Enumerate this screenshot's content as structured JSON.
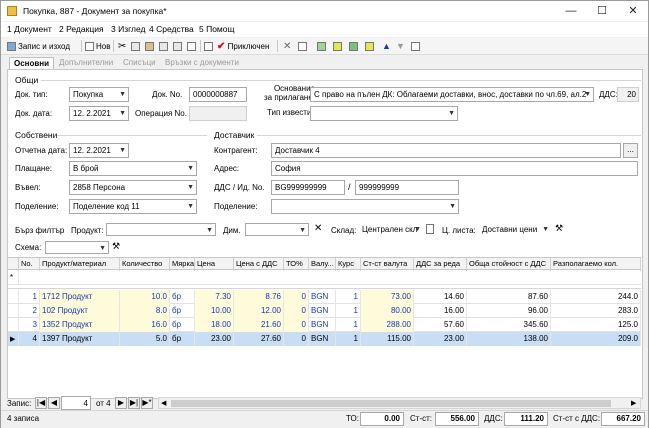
{
  "window": {
    "title": "Покупка, 887 - Документ за покупка*"
  },
  "menu": [
    "1 Документ",
    "2 Редакция",
    "3 Изглед",
    "4 Средства",
    "5 Помощ"
  ],
  "toolbar": {
    "save_close": "Запис и изход",
    "new": "Нов",
    "confirmed": "Приключен"
  },
  "tabs": [
    "Основни",
    "Допълнителни",
    "Списъци",
    "Връзки с документи"
  ],
  "general": {
    "group": "Общи",
    "doc_type_label": "Док. тип:",
    "doc_type": "Покупка",
    "doc_no_label": "Док. No.",
    "doc_no": "0000000887",
    "doc_date_label": "Док. дата:",
    "doc_date": "12.  2.2021",
    "op_no_label": "Операция No.",
    "op_no": "",
    "basis_label_1": "Основание",
    "basis_label_2": "за прилагане:",
    "basis": "С право на пълен ДК: Облагаеми доставки, внос, доставки по чл.69, ал.2",
    "vat_label": "ДДС:",
    "vat": "20",
    "notice_label": "Тип известие:",
    "notice": ""
  },
  "own": {
    "group": "Собствени",
    "report_date_label": "Отчетна дата:",
    "report_date": "12.  2.2021",
    "payment_label": "Плащане:",
    "payment": "В брой",
    "entered_label": "Въвел:",
    "entered": "2858 Персона",
    "division_label": "Поделение:",
    "division": "Поделение код 11"
  },
  "supplier": {
    "group": "Доставчик",
    "partner_label": "Контрагент:",
    "partner": "Доставчик 4",
    "address_label": "Адрес:",
    "address": "София",
    "vat_id_label": "ДДС / Ид. No.",
    "vat_id": "BG999999999",
    "id_no": "999999999",
    "division_label": "Поделение:",
    "division": ""
  },
  "filter": {
    "quick_label": "Бърз филтър",
    "product_label": "Продукт:",
    "dim_label": "Дим.",
    "store_label": "Склад:",
    "store": "Централен скл",
    "pricelist_label": "Ц. листа:",
    "pricelist": "Доставни цени",
    "scheme_label": "Схема:"
  },
  "grid": {
    "columns": [
      "No.",
      "Продукт/материал",
      "Количество",
      "Мярка",
      "Цена",
      "Цена с ДДС",
      "ТО%",
      "Валу...",
      "Курс",
      "Ст-ст валута",
      "ДДС за реда",
      "Обща стойност с ДДС",
      "Разполагаемо кол."
    ],
    "new_row_marker": "*",
    "rows": [
      {
        "no": "1",
        "product": "1712 Продукт",
        "qty": "10.0",
        "unit": "бр",
        "price": "7.30",
        "price_vat": "8.76",
        "to": "0",
        "cur": "BGN",
        "rate": "1",
        "val": "73.00",
        "vat": "14.60",
        "total": "87.60",
        "avail": "244.0"
      },
      {
        "no": "2",
        "product": "102 Продукт",
        "qty": "8.0",
        "unit": "бр",
        "price": "10.00",
        "price_vat": "12.00",
        "to": "0",
        "cur": "BGN",
        "rate": "1",
        "val": "80.00",
        "vat": "16.00",
        "total": "96.00",
        "avail": "283.0"
      },
      {
        "no": "3",
        "product": "1352 Продукт",
        "qty": "16.0",
        "unit": "бр",
        "price": "18.00",
        "price_vat": "21.60",
        "to": "0",
        "cur": "BGN",
        "rate": "1",
        "val": "288.00",
        "vat": "57.60",
        "total": "345.60",
        "avail": "125.0"
      },
      {
        "no": "4",
        "product": "1397 Продукт",
        "qty": "5.0",
        "unit": "бр",
        "price": "23.00",
        "price_vat": "27.60",
        "to": "0",
        "cur": "BGN",
        "rate": "1",
        "val": "115.00",
        "vat": "23.00",
        "total": "138.00",
        "avail": "209.0"
      }
    ]
  },
  "nav": {
    "record_label": "Запис:",
    "current": "4",
    "of": "от 4"
  },
  "status": {
    "records": "4 записа",
    "to_label": "ТО:",
    "to": "0.00",
    "cost_label": "Ст-ст:",
    "cost": "556.00",
    "vat_label": "ДДС:",
    "vat": "111.20",
    "cost_vat_label": "Ст-ст с ДДС:",
    "cost_vat": "667.20"
  }
}
